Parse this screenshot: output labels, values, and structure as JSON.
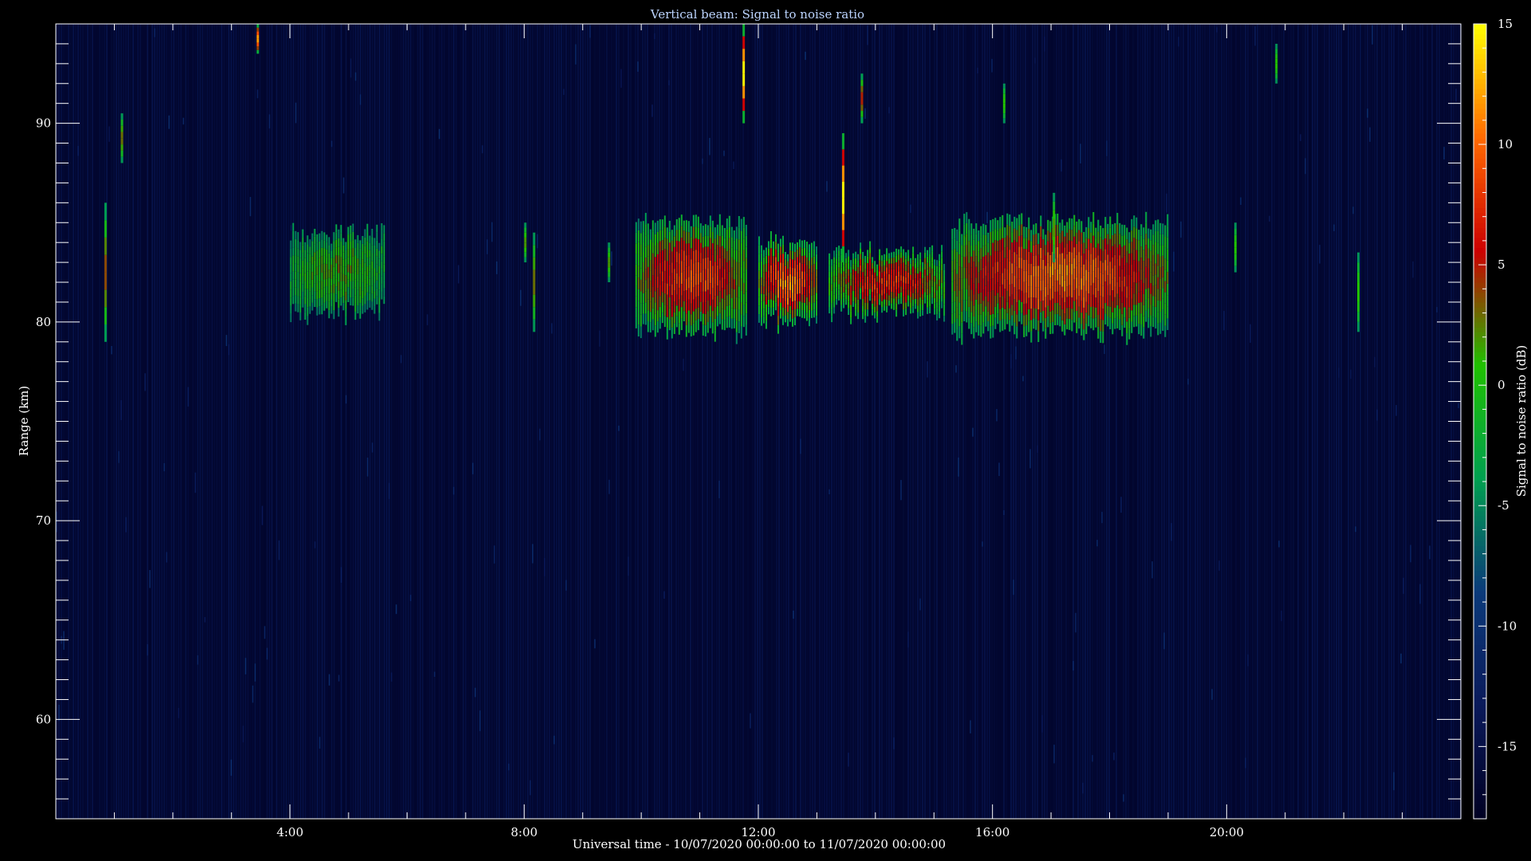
{
  "chart_data": {
    "type": "heatmap",
    "title": "Vertical beam: Signal to noise ratio",
    "xlabel": "Universal time - 10/07/2020 00:00:00 to 11/07/2020 00:00:00",
    "ylabel": "Range (km)",
    "colorbar_label": "Signal to noise ratio (dB)",
    "xlim": [
      0,
      24
    ],
    "ylim": [
      55,
      95
    ],
    "x_ticks": [
      {
        "value": 4,
        "label": "4:00"
      },
      {
        "value": 8,
        "label": "8:00"
      },
      {
        "value": 12,
        "label": "12:00"
      },
      {
        "value": 16,
        "label": "16:00"
      },
      {
        "value": 20,
        "label": "20:00"
      }
    ],
    "y_ticks": [
      {
        "value": 60,
        "label": "60"
      },
      {
        "value": 70,
        "label": "70"
      },
      {
        "value": 80,
        "label": "80"
      },
      {
        "value": 90,
        "label": "90"
      }
    ],
    "colorbar_range": [
      -18,
      15
    ],
    "colorbar_ticks": [
      {
        "value": -15,
        "label": "-15"
      },
      {
        "value": -10,
        "label": "-10"
      },
      {
        "value": -5,
        "label": "-5"
      },
      {
        "value": 0,
        "label": "0"
      },
      {
        "value": 5,
        "label": "5"
      },
      {
        "value": 10,
        "label": "10"
      },
      {
        "value": 15,
        "label": "15"
      }
    ],
    "colormap": [
      "#000022",
      "#0a1a5a",
      "#0b3a7a",
      "#00a050",
      "#20c000",
      "#cc0000",
      "#ff6a00",
      "#ffff00"
    ],
    "background_snr_db": -17,
    "echo_layers": [
      {
        "t_start": 4.0,
        "t_end": 5.6,
        "r_bottom": 80.5,
        "r_top": 84.5,
        "peak_snr_db": 2
      },
      {
        "t_start": 9.9,
        "t_end": 11.8,
        "r_bottom": 79.5,
        "r_top": 85.0,
        "peak_snr_db": 9
      },
      {
        "t_start": 12.0,
        "t_end": 13.0,
        "r_bottom": 80.0,
        "r_top": 84.0,
        "peak_snr_db": 11
      },
      {
        "t_start": 13.2,
        "t_end": 15.2,
        "r_bottom": 80.5,
        "r_top": 83.5,
        "peak_snr_db": 8
      },
      {
        "t_start": 15.3,
        "t_end": 19.0,
        "r_bottom": 79.5,
        "r_top": 85.0,
        "peak_snr_db": 11
      }
    ],
    "isolated_echoes": [
      {
        "t": 0.85,
        "r_bottom": 79.0,
        "r_top": 86.0,
        "peak_snr_db": 4
      },
      {
        "t": 1.13,
        "r_bottom": 88.0,
        "r_top": 90.5,
        "peak_snr_db": 3
      },
      {
        "t": 3.45,
        "r_bottom": 93.5,
        "r_top": 95.0,
        "peak_snr_db": 12
      },
      {
        "t": 8.02,
        "r_bottom": 83.0,
        "r_top": 85.0,
        "peak_snr_db": 2
      },
      {
        "t": 8.17,
        "r_bottom": 79.5,
        "r_top": 84.5,
        "peak_snr_db": 3
      },
      {
        "t": 9.45,
        "r_bottom": 82.0,
        "r_top": 84.0,
        "peak_snr_db": 2
      },
      {
        "t": 11.75,
        "r_bottom": 90.0,
        "r_top": 95.0,
        "peak_snr_db": 15
      },
      {
        "t": 13.45,
        "r_bottom": 83.0,
        "r_top": 89.5,
        "peak_snr_db": 15
      },
      {
        "t": 13.77,
        "r_bottom": 90.0,
        "r_top": 92.5,
        "peak_snr_db": 5
      },
      {
        "t": 16.2,
        "r_bottom": 90.0,
        "r_top": 92.0,
        "peak_snr_db": 1
      },
      {
        "t": 17.05,
        "r_bottom": 83.0,
        "r_top": 86.5,
        "peak_snr_db": 2
      },
      {
        "t": 20.15,
        "r_bottom": 82.5,
        "r_top": 85.0,
        "peak_snr_db": 1
      },
      {
        "t": 20.85,
        "r_bottom": 92.0,
        "r_top": 94.0,
        "peak_snr_db": 1
      },
      {
        "t": 22.25,
        "r_bottom": 79.5,
        "r_top": 83.5,
        "peak_snr_db": 1
      }
    ]
  }
}
